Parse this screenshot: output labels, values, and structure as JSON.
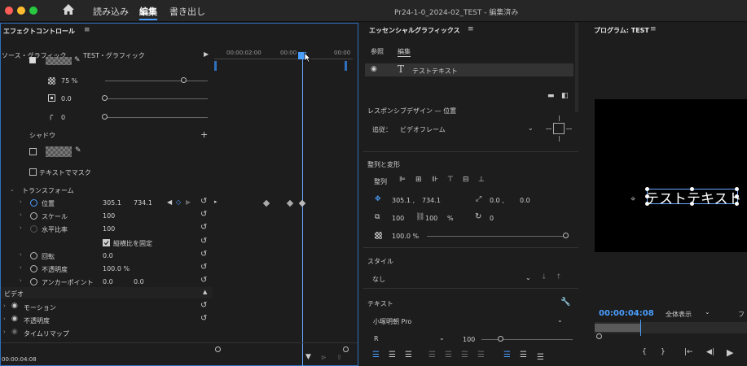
{
  "titlebar": {
    "nav": [
      "読み込み",
      "編集",
      "書き出し"
    ],
    "title": "Pr24-1-0_2024-02_TEST - 編集済み"
  },
  "effect_controls": {
    "panel_title": "エフェクトコントロール",
    "source": "ソース・グラフィック",
    "sequence": "TEST・グラフィック",
    "timecodes": [
      "00:00:02:00",
      "00:00",
      "00:00"
    ],
    "opacity_pct": "75 %",
    "square_value": "0.0",
    "corner_value": "0",
    "shadow_label": "シャドウ",
    "mask_label": "テキストでマスク",
    "transform_label": "トランスフォーム",
    "position_label": "位置",
    "position_x": "305.1",
    "position_y": "734.1",
    "scale_label": "スケール",
    "scale_value": "100",
    "hscale_label": "水平比率",
    "hscale_value": "100",
    "lock_label": "縦横比を固定",
    "rotation_label": "回転",
    "rotation_value": "0.0",
    "opacity_label": "不透明度",
    "opacity_value": "100.0 %",
    "anchor_label": "アンカーポイント",
    "anchor_x": "0.0",
    "anchor_y": "0.0",
    "video_label": "ビデオ",
    "motion_label": "モーション",
    "opacity2_label": "不透明度",
    "timeremap_label": "タイムリマップ",
    "current_time": "00:00:04:08"
  },
  "essential_graphics": {
    "panel_title": "エッセンシャルグラフィックス",
    "tabs": [
      "参照",
      "編集"
    ],
    "layer_name": "テストテキスト",
    "responsive_label": "レスポンシブデザイン — 位置",
    "follow_label": "追従：",
    "follow_value": "ビデオフレーム",
    "align_section": "整列と変形",
    "align_label": "整列",
    "pos_x": "305.1 ,",
    "pos_y": "734.1",
    "anchor_x": "0.0 ,",
    "anchor_y": "0.0",
    "scale_w": "100",
    "scale_h": "100",
    "scale_unit": "%",
    "rotation": "0",
    "opacity": "100.0 %",
    "style_label": "スタイル",
    "style_value": "なし",
    "text_label": "テキスト",
    "font_name": "小塚明朝 Pro",
    "font_style": "R",
    "font_size": "100"
  },
  "program": {
    "panel_title": "プログラム: TEST",
    "preview_text": "テストテキスト",
    "timecode": "00:00:04:08",
    "zoom": "全体表示",
    "cut_label": "フ"
  }
}
